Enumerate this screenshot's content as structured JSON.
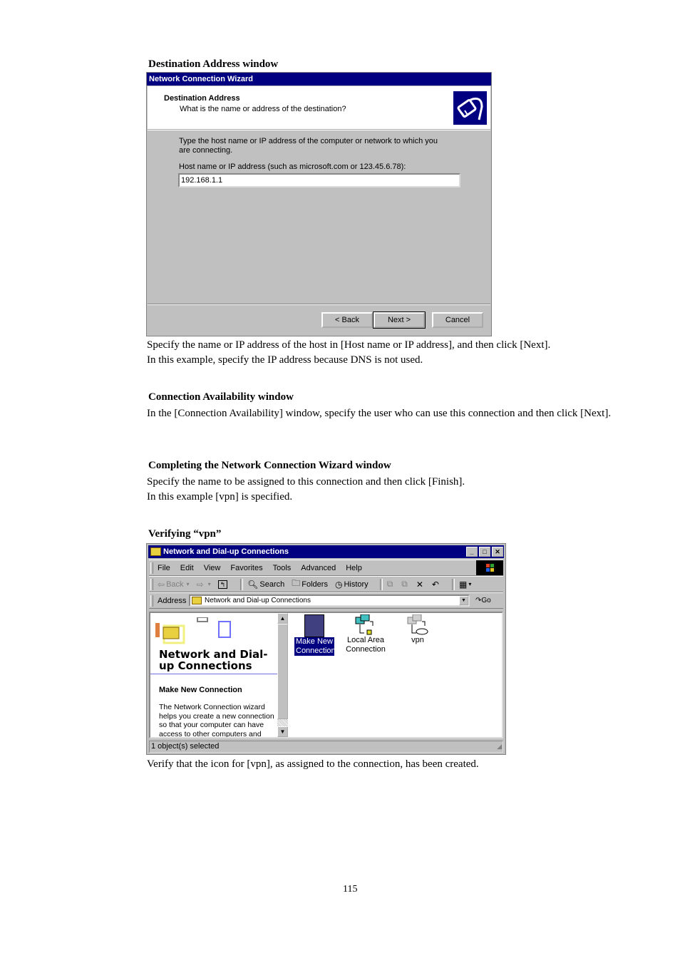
{
  "section1": {
    "heading": "Destination Address window",
    "wizard": {
      "title": "Network Connection Wizard",
      "header_title": "Destination Address",
      "header_subtitle": "What is the name or address of the destination?",
      "icon": "network-cable-icon",
      "instruction": "Type the host name or IP address of the computer or network to which you are connecting.",
      "field_label": "Host name or IP address (such as microsoft.com or 123.45.6.78):",
      "field_value": "192.168.1.1",
      "buttons": {
        "back": "< Back",
        "next": "Next >",
        "cancel": "Cancel"
      }
    },
    "para1": "Specify the name or IP address of the host in [Host name or IP address], and then click [Next].",
    "para2": "In this example, specify the IP address because DNS is not used."
  },
  "section2": {
    "heading": "Connection Availability window",
    "para": "In the [Connection Availability] window, specify the user who can use this connection and then click [Next]."
  },
  "section3": {
    "heading": "Completing the Network Connection Wizard window",
    "para1": "Specify the name to be assigned to this connection and then click [Finish].",
    "para2": "In this example [vpn] is specified."
  },
  "section4": {
    "heading": "Verifying “vpn”",
    "explorer": {
      "title": "Network and Dial-up Connections",
      "menu": [
        "File",
        "Edit",
        "View",
        "Favorites",
        "Tools",
        "Advanced",
        "Help"
      ],
      "toolbar": {
        "back": "Back",
        "search": "Search",
        "folders": "Folders",
        "history": "History"
      },
      "address_label": "Address",
      "address_value": "Network and Dial-up Connections",
      "go_label": "Go",
      "left_title": "Network and Dial-up Connections",
      "left_subtitle": "Make New Connection",
      "left_text": "The Network Connection wizard helps you create a new connection so that your computer can have access to other computers and",
      "icons": [
        {
          "label": "Make New Connection",
          "selected": true
        },
        {
          "label": "Local Area Connection",
          "selected": false
        },
        {
          "label": "vpn",
          "selected": false
        }
      ],
      "status": "1 object(s) selected"
    },
    "para": "Verify that the icon for [vpn], as assigned to the connection, has been created."
  },
  "page_number": "115"
}
